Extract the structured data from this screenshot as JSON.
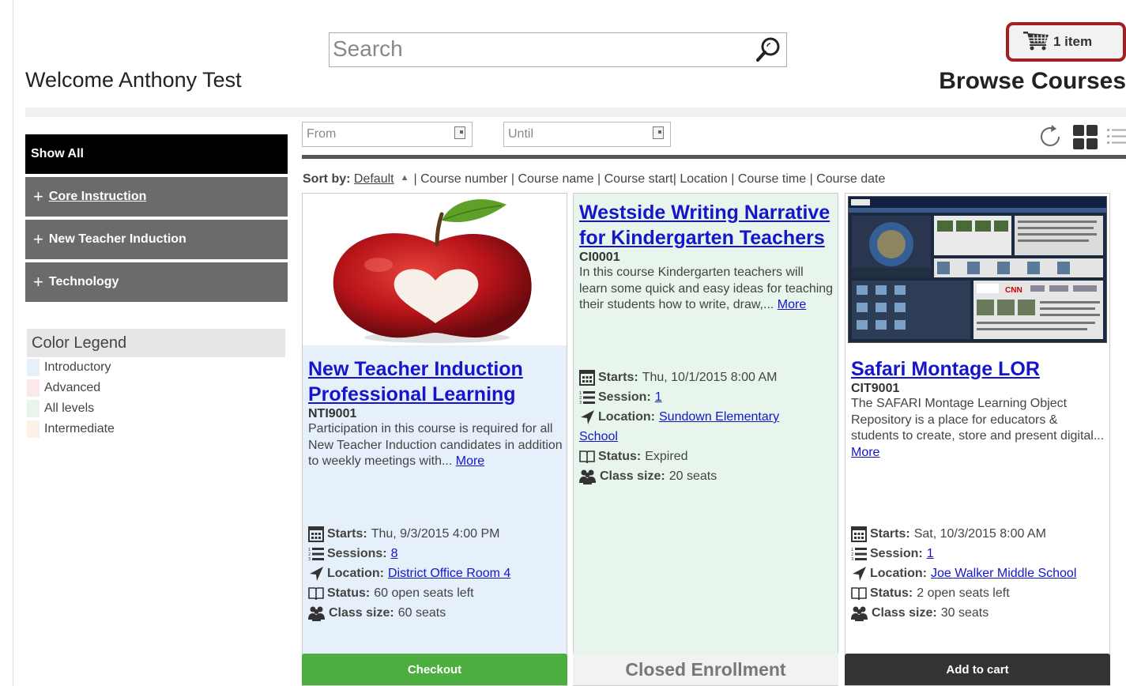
{
  "header": {
    "welcome": "Welcome Anthony Test",
    "search_placeholder": "Search",
    "cart_label": "1 item",
    "page_title": "Browse Courses"
  },
  "sidebar": {
    "items": [
      {
        "label": "Show All",
        "active": true
      },
      {
        "label": "Core Instruction",
        "expand": "+"
      },
      {
        "label": "New Teacher Induction",
        "expand": "+"
      },
      {
        "label": "Technology",
        "expand": "+"
      }
    ]
  },
  "legend": {
    "title": "Color Legend",
    "items": [
      {
        "label": "Introductory",
        "color": "#e6f0fb"
      },
      {
        "label": "Advanced",
        "color": "#fbe9e9"
      },
      {
        "label": "All levels",
        "color": "#e7f5ec"
      },
      {
        "label": "Intermediate",
        "color": "#fdf0e4"
      }
    ]
  },
  "filters": {
    "from_placeholder": "From",
    "until_placeholder": "Until"
  },
  "sort": {
    "label": "Sort by:",
    "options": [
      "Default",
      "Course number",
      "Course name",
      "Course start",
      "Location",
      "Course time",
      "Course date"
    ],
    "separator": "|"
  },
  "courses": [
    {
      "title": "New Teacher Induction Professional Learning",
      "code": "NTI9001",
      "description": "Participation in this course is required for all New Teacher Induction candidates in addition to weekly meetings with...",
      "more": "More",
      "starts_label": "Starts:",
      "starts": "Thu, 9/3/2015 4:00 PM",
      "sessions_label": "Sessions:",
      "sessions": "8",
      "location_label": "Location:",
      "location": "District Office Room 4",
      "status_label": "Status:",
      "status": "60 open seats left",
      "size_label": "Class size:",
      "size": "60 seats",
      "action": "Checkout",
      "bg": "#e6f0fb",
      "action_color": "#4cae3f"
    },
    {
      "title": "Westside Writing Narrative for Kindergarten Teachers",
      "code": "CI0001",
      "description": "In this course Kindergarten teachers will learn some quick and easy ideas for teaching their students how to write, draw,...",
      "more": "More",
      "starts_label": "Starts:",
      "starts": "Thu, 10/1/2015 8:00 AM",
      "sessions_label": "Session:",
      "sessions": "1",
      "location_label": "Location:",
      "location_a": "Sundown Elementary",
      "location_b": "School",
      "status_label": "Status:",
      "status": "Expired",
      "size_label": "Class size:",
      "size": "20 seats",
      "action": "Closed Enrollment",
      "bg": "#e7f5ec"
    },
    {
      "title": "Safari Montage LOR",
      "code": "CIT9001",
      "description": "The SAFARI Montage Learning Object Repository is a place for educators & students to create, store and present digital...",
      "more": "More",
      "starts_label": "Starts:",
      "starts": "Sat, 10/3/2015 8:00 AM",
      "sessions_label": "Session:",
      "sessions": "1",
      "location_label": "Location:",
      "location": "Joe Walker Middle School",
      "status_label": "Status:",
      "status": "2 open seats left",
      "size_label": "Class size:",
      "size": "30 seats",
      "action": "Add to cart",
      "bg": "#ffffff",
      "action_color": "#333333"
    }
  ]
}
